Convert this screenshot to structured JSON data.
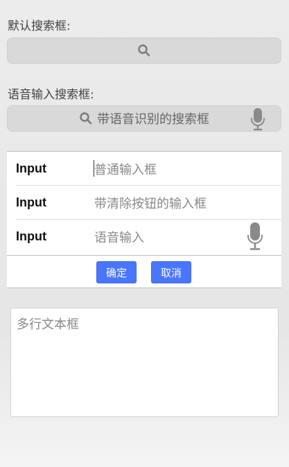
{
  "default_search": {
    "label": "默认搜索框:",
    "icon": "search-icon"
  },
  "voice_search": {
    "label": "语音输入搜索框:",
    "placeholder": "带语音识别的搜索框",
    "icons": [
      "search-icon",
      "microphone-icon"
    ]
  },
  "form": {
    "rows": [
      {
        "label": "Input",
        "placeholder": "普通输入框"
      },
      {
        "label": "Input",
        "placeholder": "带清除按钮的输入框"
      },
      {
        "label": "Input",
        "placeholder": "语音输入",
        "icon": "microphone-icon"
      }
    ],
    "confirm_label": "确定",
    "cancel_label": "取消"
  },
  "textarea": {
    "placeholder": "多行文本框"
  },
  "colors": {
    "accent": "#4a76ff",
    "search_bg": "#d9d9d9"
  }
}
